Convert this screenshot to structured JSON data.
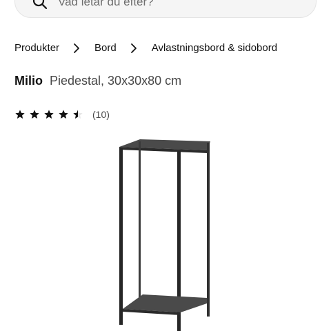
{
  "search": {
    "placeholder": "Vad letar du efter?",
    "icon": "search-icon"
  },
  "breadcrumb": {
    "items": [
      {
        "label": "Produkter"
      },
      {
        "label": "Bord"
      },
      {
        "label": "Avlastningsbord & sidobord"
      }
    ],
    "separator_icon": "chevron-right-icon"
  },
  "product": {
    "name": "Milio",
    "description": "Piedestal, 30x30x80 cm",
    "rating": {
      "value": 4.5,
      "max": 5,
      "count_label": "(10)"
    },
    "image": "black-metal-pedestal-stand"
  },
  "colors": {
    "text": "#111111",
    "muted_text": "#484848",
    "search_bg": "#f5f5f5",
    "product_metal": "#333333"
  }
}
